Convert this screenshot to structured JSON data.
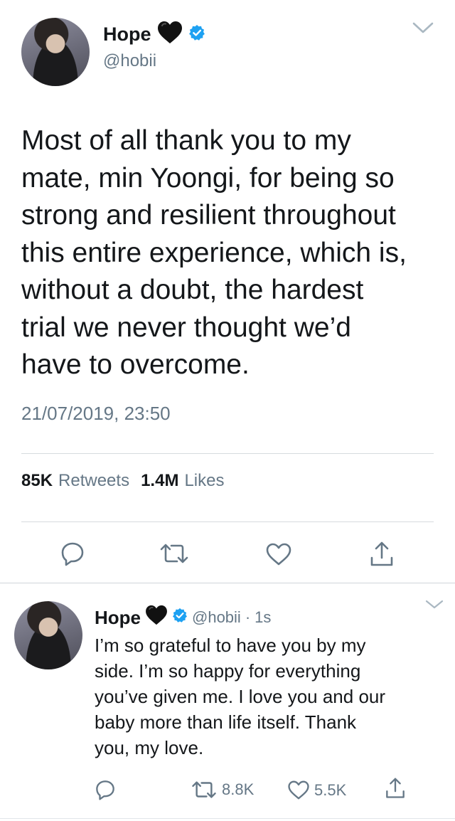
{
  "main_tweet": {
    "display_name": "Hope",
    "handle": "@hobii",
    "text": "Most of all thank you to my\nmate, min Yoongi, for being so\nstrong and resilient throughout\nthis entire experience, which is,\nwithout a doubt, the hardest\ntrial we never thought we’d\nhave to overcome.",
    "timestamp": "21/07/2019, 23:50",
    "retweets_count": "85K",
    "retweets_label": "Retweets",
    "likes_count": "1.4M",
    "likes_label": "Likes"
  },
  "reply_tweet": {
    "display_name": "Hope",
    "handle": "@hobii",
    "separator": "·",
    "time": "1s",
    "text": "I’m so grateful to have you by my\nside. I’m so happy for everything\nyou’ve given me. I love you and our\nbaby more than life itself. Thank\nyou, my love.",
    "retweet_count": "8.8K",
    "like_count": "5.5K"
  },
  "colors": {
    "text": "#14171a",
    "secondary": "#657786",
    "verified": "#1da1f2",
    "divider": "#d6dbdf"
  },
  "icons": {
    "emoji": "black-heart-icon",
    "badge": "verified-badge-icon",
    "menu": "chevron-down-icon",
    "reply": "reply-icon",
    "retweet": "retweet-icon",
    "like": "like-icon",
    "share": "share-icon"
  }
}
